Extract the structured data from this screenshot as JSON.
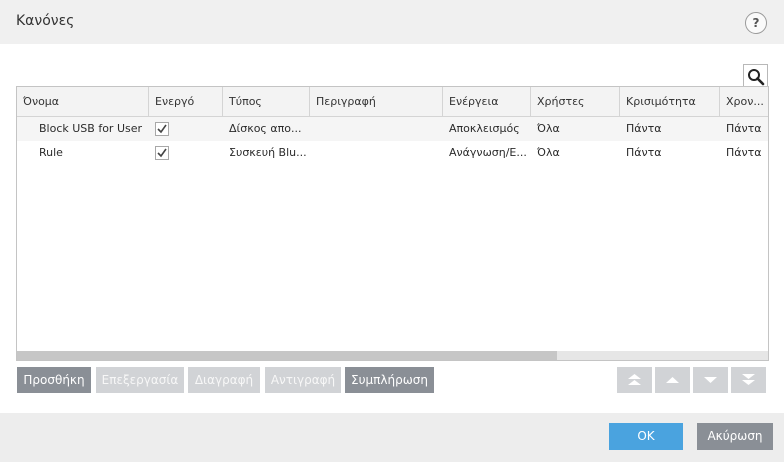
{
  "dialog": {
    "title": "Κανόνες",
    "help_label": "?"
  },
  "table": {
    "columns": [
      "Όνομα",
      "Ενεργό",
      "Τύπος",
      "Περιγραφή",
      "Ενέργεια",
      "Χρήστες",
      "Κρισιμότητα",
      "Χρον..."
    ],
    "rows": [
      {
        "name": "Block USB for User",
        "enabled": true,
        "type": "Δίσκος απο...",
        "description": "",
        "action": "Αποκλεισμός",
        "users": "Όλα",
        "severity": "Πάντα",
        "time": "Πάντα"
      },
      {
        "name": "Rule",
        "enabled": true,
        "type": "Συσκευή Blu...",
        "description": "",
        "action": "Ανάγνωση/Ε...",
        "users": "Όλα",
        "severity": "Πάντα",
        "time": "Πάντα"
      }
    ]
  },
  "toolbar": {
    "add_label": "Προσθήκη",
    "edit_label": "Επεξεργασία",
    "delete_label": "Διαγραφή",
    "copy_label": "Αντιγραφή",
    "populate_label": "Συμπλήρωση"
  },
  "footer": {
    "ok_label": "OK",
    "cancel_label": "Ακύρωση"
  },
  "icons": {
    "search": "search-icon",
    "move_top": "move-top-icon",
    "move_up": "move-up-icon",
    "move_down": "move-down-icon",
    "move_bottom": "move-bottom-icon",
    "checkbox": "checkmark-icon"
  },
  "colors": {
    "primary": "#4aa3df",
    "secondary": "#8a8f96",
    "disabled": "#d1d3d6"
  }
}
